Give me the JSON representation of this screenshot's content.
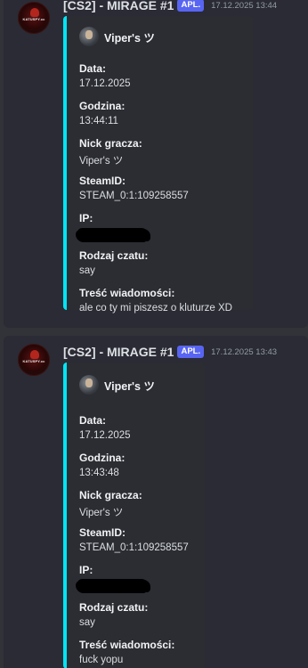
{
  "messages": [
    {
      "username": "[CS2] - MIRAGE #1",
      "tag": "APL.",
      "timestamp": "17.12.2025 13:44",
      "avatar_text": "KATUSPY.cc",
      "embed": {
        "author": "Viper's ツ",
        "accent_color": "#00e5f5",
        "fields": [
          {
            "name": "Data:",
            "value": "17.12.2025"
          },
          {
            "name": "Godzina:",
            "value": "13:44:11"
          },
          {
            "name": "Nick gracza:",
            "value": "Viper's ツ"
          },
          {
            "name": "SteamID:",
            "value": "STEAM_0:1:109258557"
          },
          {
            "name": "IP:",
            "value": ""
          },
          {
            "name": "Rodzaj czatu:",
            "value": "say"
          },
          {
            "name": "Treść wiadomości:",
            "value": "ale co ty mi piszesz o kluturze XD"
          }
        ]
      }
    },
    {
      "username": "[CS2] - MIRAGE #1",
      "tag": "APL.",
      "timestamp": "17.12.2025 13:43",
      "avatar_text": "KATUSPY.cc",
      "embed": {
        "author": "Viper's ツ",
        "accent_color": "#00e5f5",
        "fields": [
          {
            "name": "Data:",
            "value": "17.12.2025"
          },
          {
            "name": "Godzina:",
            "value": "13:43:48"
          },
          {
            "name": "Nick gracza:",
            "value": "Viper's ツ"
          },
          {
            "name": "SteamID:",
            "value": "STEAM_0:1:109258557"
          },
          {
            "name": "IP:",
            "value": ""
          },
          {
            "name": "Rodzaj czatu:",
            "value": "say"
          },
          {
            "name": "Treść wiadomości:",
            "value": "fuck yopu"
          }
        ]
      }
    }
  ]
}
